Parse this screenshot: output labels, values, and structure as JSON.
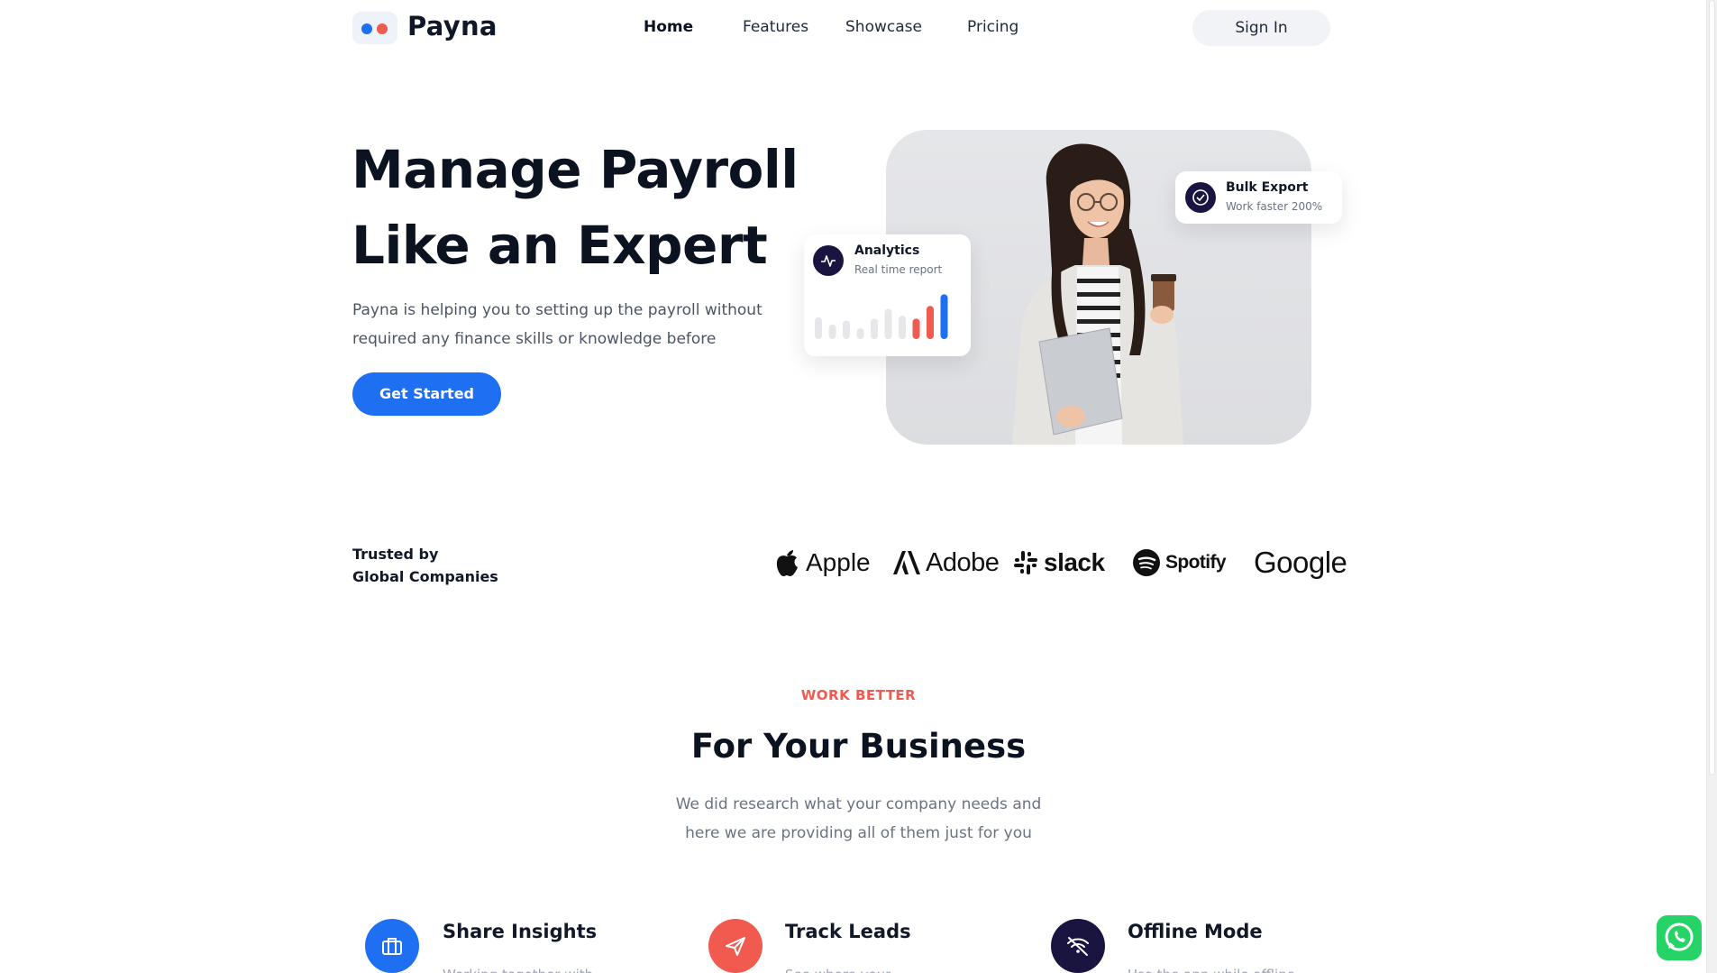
{
  "header": {
    "brand": "Payna",
    "nav": [
      "Home",
      "Features",
      "Showcase",
      "Pricing"
    ],
    "active_nav": "Home",
    "signin_label": "Sign In"
  },
  "hero": {
    "title_line1": "Manage Payroll",
    "title_line2": "Like an Expert",
    "description_line1": "Payna is helping you to setting up the payroll without",
    "description_line2": "required any finance skills or knowledge before",
    "cta_label": "Get Started",
    "analytics_card": {
      "title": "Analytics",
      "subtitle": "Real time report",
      "bars": [
        {
          "value": 0.45,
          "color": "#e5e7eb"
        },
        {
          "value": 0.3,
          "color": "#e5e7eb"
        },
        {
          "value": 0.38,
          "color": "#e5e7eb"
        },
        {
          "value": 0.22,
          "color": "#e5e7eb"
        },
        {
          "value": 0.42,
          "color": "#e5e7eb"
        },
        {
          "value": 0.62,
          "color": "#e5e7eb"
        },
        {
          "value": 0.48,
          "color": "#e5e7eb"
        },
        {
          "value": 0.42,
          "color": "#f05a4f"
        },
        {
          "value": 0.68,
          "color": "#f05a4f"
        },
        {
          "value": 0.92,
          "color": "#1f6ff2"
        }
      ]
    },
    "export_card": {
      "title": "Bulk Export",
      "subtitle": "Work faster 200%"
    }
  },
  "trusted": {
    "line1": "Trusted by",
    "line2": "Global Companies",
    "logos": [
      "Apple",
      "Adobe",
      "slack",
      "Spotify",
      "Google"
    ]
  },
  "section": {
    "eyebrow": "WORK BETTER",
    "title": "For Your Business",
    "desc_line1": "We did research what your company needs and",
    "desc_line2": "here we are providing all of them just for you"
  },
  "features": [
    {
      "title": "Share Insights",
      "icon": "briefcase-icon",
      "color": "#1f6ff2",
      "desc": "Working together with"
    },
    {
      "title": "Track Leads",
      "icon": "paper-plane-icon",
      "color": "#f05a4f",
      "desc": "See where your"
    },
    {
      "title": "Offline Mode",
      "icon": "wifi-off-icon",
      "color": "#1a1440",
      "desc": "Use the app while offline"
    }
  ],
  "colors": {
    "primary": "#1f6ff2",
    "accent": "#f05a4f",
    "dark": "#1a1440",
    "whatsapp": "#25d366"
  }
}
